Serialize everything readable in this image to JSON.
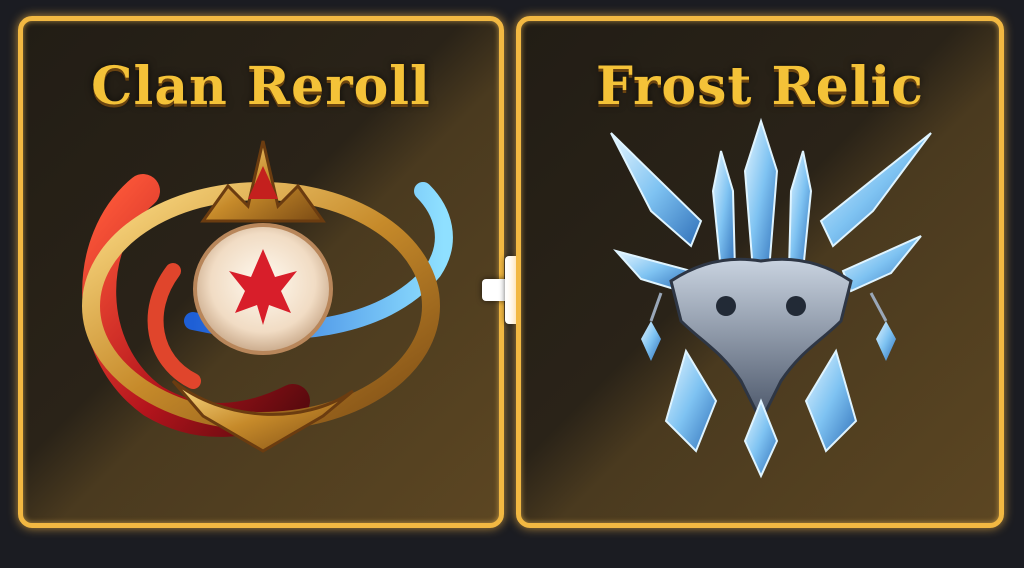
{
  "cards": [
    {
      "title": "Clan Reroll",
      "icon": "clan-reroll-emblem-icon"
    },
    {
      "title": "Frost Relic",
      "icon": "frost-relic-crystal-icon"
    }
  ],
  "plus_symbol": "+",
  "colors": {
    "background": "#1b1c22",
    "card_border": "#f2b842",
    "title_gold": "#f4c238",
    "fire_red": "#c4201e",
    "ice_blue": "#7fc3f2"
  }
}
